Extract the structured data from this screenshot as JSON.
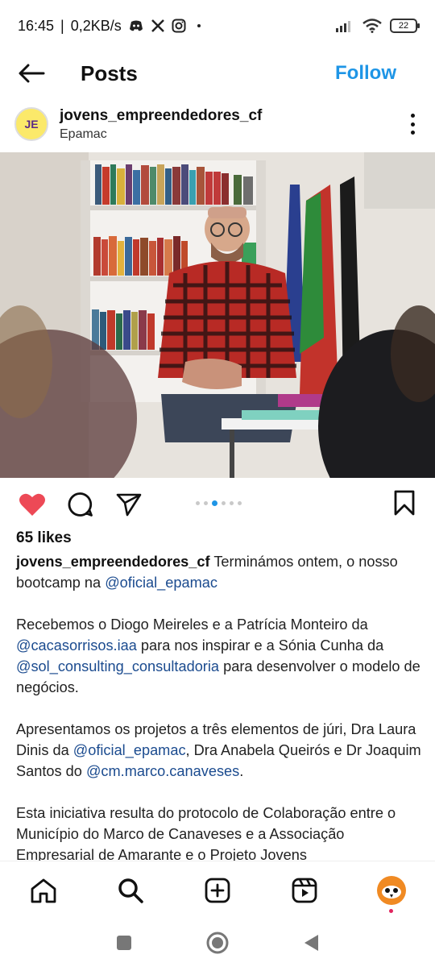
{
  "status_bar": {
    "time": "16:45",
    "network_speed": "0,2KB/s",
    "battery": "22",
    "icons": [
      "discord-icon",
      "x-icon",
      "instagram-icon",
      "signal-icon",
      "wifi-icon",
      "battery-icon"
    ]
  },
  "header": {
    "title": "Posts",
    "follow_label": "Follow"
  },
  "post": {
    "author": {
      "username": "jovens_empreendedores_cf",
      "subtitle": "Epamac",
      "avatar_initials": "JE"
    },
    "likes_text": "65 likes",
    "carousel": {
      "count": 6,
      "active_index": 2
    },
    "caption": {
      "username": "jovens_empreendedores_cf",
      "p1_text": " Terminámos ontem, o nosso bootcamp na ",
      "p1_mention": "@oficial_epamac",
      "p2_a": "Recebemos o Diogo Meireles e a Patrícia Monteiro da ",
      "p2_mention1": "@cacasorrisos.iaa",
      "p2_b": " para nos inspirar e a Sónia Cunha da ",
      "p2_mention2": "@sol_consulting_consultadoria",
      "p2_c": " para desenvolver o modelo de negócios.",
      "p3_a": "Apresentamos os projetos a três elementos de júri, Dra Laura Dinis da ",
      "p3_mention1": "@oficial_epamac",
      "p3_b": ", Dra Anabela Queirós e Dr Joaquim Santos do ",
      "p3_mention2": "@cm.marco.canaveses",
      "p3_c": ".",
      "p4": "Esta iniciativa resulta do protocolo de Colaboração entre o Município do Marco de Canaveses e a Associação Empresarial de Amarante e o Projeto Jovens"
    }
  },
  "colors": {
    "accent_blue": "#1e95e6",
    "like_red": "#ed4956",
    "mention_blue": "#1b4b8f"
  }
}
